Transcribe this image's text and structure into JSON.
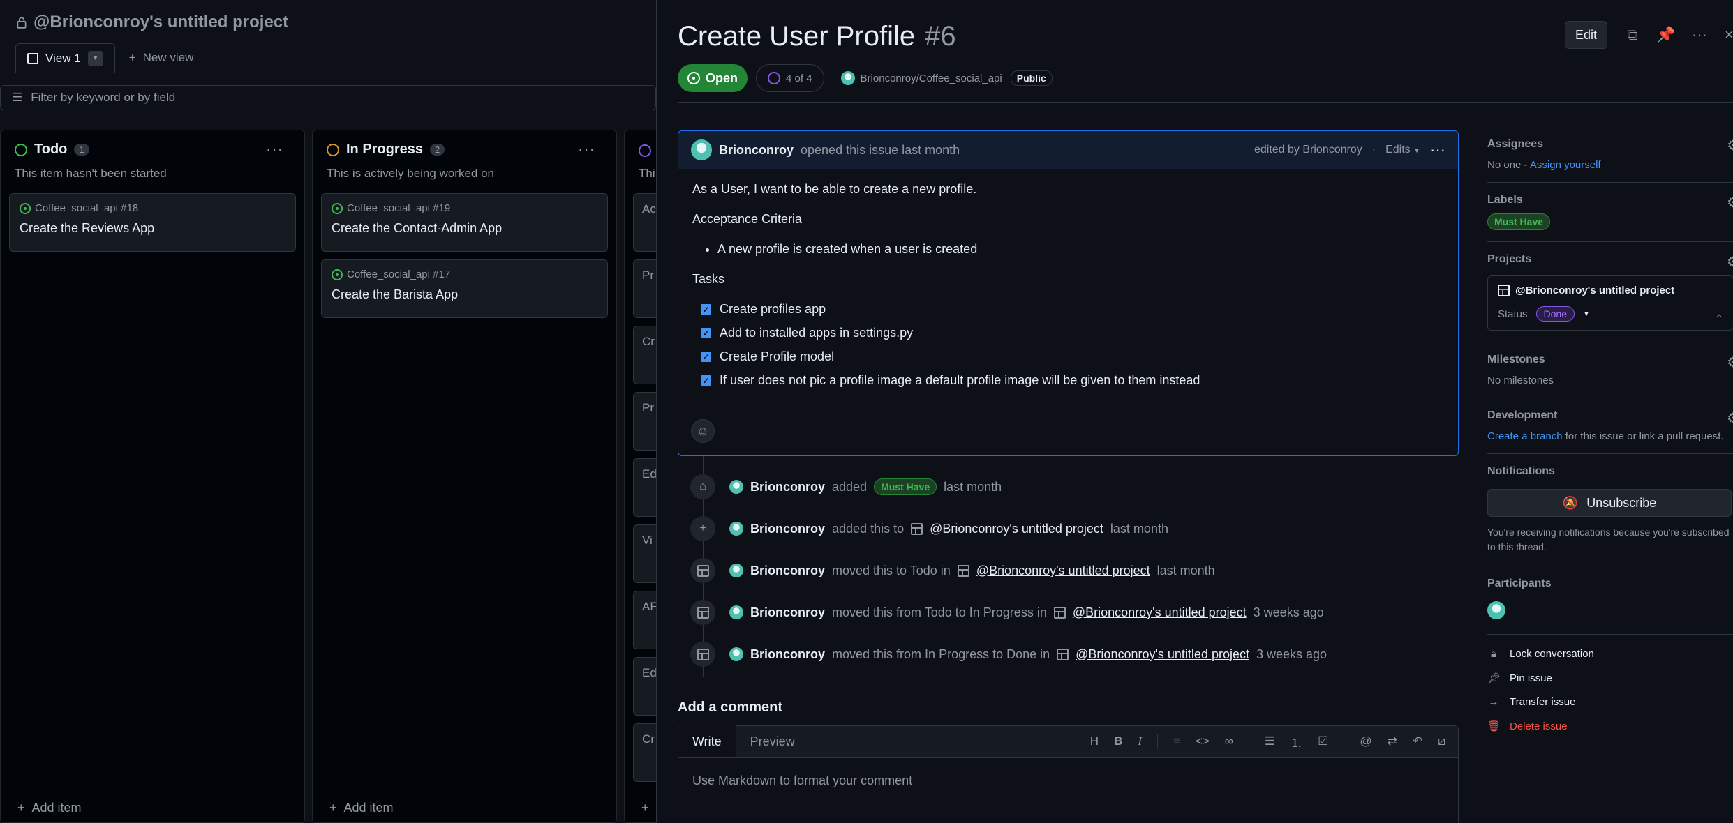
{
  "board": {
    "title": "@Brionconroy's untitled project",
    "view_tab": "View 1",
    "new_view": "New view",
    "filter_placeholder": "Filter by keyword or by field",
    "add_item": "Add item",
    "columns": [
      {
        "name": "Todo",
        "count": "1",
        "desc": "This item hasn't been started",
        "color": "#3fb950",
        "cards": [
          {
            "repo": "Coffee_social_api #18",
            "title": "Create the Reviews App"
          }
        ]
      },
      {
        "name": "In Progress",
        "count": "2",
        "desc": "This is actively being worked on",
        "color": "#d29922",
        "cards": [
          {
            "repo": "Coffee_social_api #19",
            "title": "Create the Contact-Admin App"
          },
          {
            "repo": "Coffee_social_api #17",
            "title": "Create the Barista App"
          }
        ]
      },
      {
        "name": "",
        "desc": "Thi",
        "color": "#8957e5",
        "stubs": [
          "Ac",
          "Pr",
          "Cr",
          "Pr",
          "Ed",
          "Vi",
          "AF",
          "Ed",
          "Cr"
        ]
      }
    ]
  },
  "issue": {
    "title": "Create User Profile",
    "number": "#6",
    "edit_label": "Edit",
    "state": "Open",
    "progress": "4 of 4",
    "repo": "Brionconroy/Coffee_social_api",
    "visibility": "Public",
    "comment": {
      "author": "Brionconroy",
      "action": "opened this issue last month",
      "edited": "edited by Brionconroy",
      "edits_label": "Edits",
      "intro": "As a User, I want to be able to create a new profile.",
      "criteria_heading": "Acceptance Criteria",
      "criteria": [
        "A new profile is created when a user is created"
      ],
      "tasks_heading": "Tasks",
      "tasks": [
        "Create profiles app",
        "Add to installed apps in settings.py",
        "Create Profile model",
        "If user does not pic a profile image a default profile image will be given to them instead"
      ]
    },
    "timeline": [
      {
        "icon": "tag-icon",
        "author": "Brionconroy",
        "pre": "added",
        "label": "Must Have",
        "post": "last month"
      },
      {
        "icon": "plus-icon",
        "author": "Brionconroy",
        "pre": "added this to",
        "project": "@Brionconroy's untitled project",
        "post": "last month"
      },
      {
        "icon": "table-icon",
        "author": "Brionconroy",
        "pre": "moved this to Todo in",
        "project": "@Brionconroy's untitled project",
        "post": "last month"
      },
      {
        "icon": "table-icon",
        "author": "Brionconroy",
        "pre": "moved this from Todo to In Progress in",
        "project": "@Brionconroy's untitled project",
        "post": "3 weeks ago"
      },
      {
        "icon": "table-icon",
        "author": "Brionconroy",
        "pre": "moved this from In Progress to Done in",
        "project": "@Brionconroy's untitled project",
        "post": "3 weeks ago"
      }
    ],
    "add_comment": {
      "title": "Add a comment",
      "write_tab": "Write",
      "preview_tab": "Preview",
      "placeholder": "Use Markdown to format your comment"
    }
  },
  "sidebar": {
    "assignees": {
      "heading": "Assignees",
      "none": "No one -",
      "assign_link": "Assign yourself"
    },
    "labels": {
      "heading": "Labels",
      "label": "Must Have"
    },
    "projects": {
      "heading": "Projects",
      "project": "@Brionconroy's untitled project",
      "status_label": "Status",
      "status_value": "Done"
    },
    "milestones": {
      "heading": "Milestones",
      "text": "No milestones"
    },
    "development": {
      "heading": "Development",
      "link": "Create a branch",
      "text": "for this issue or link a pull request."
    },
    "notifications": {
      "heading": "Notifications",
      "button": "Unsubscribe",
      "text": "You're receiving notifications because you're subscribed to this thread."
    },
    "participants": {
      "heading": "Participants"
    },
    "actions": [
      "Lock conversation",
      "Pin issue",
      "Transfer issue",
      "Delete issue"
    ]
  }
}
